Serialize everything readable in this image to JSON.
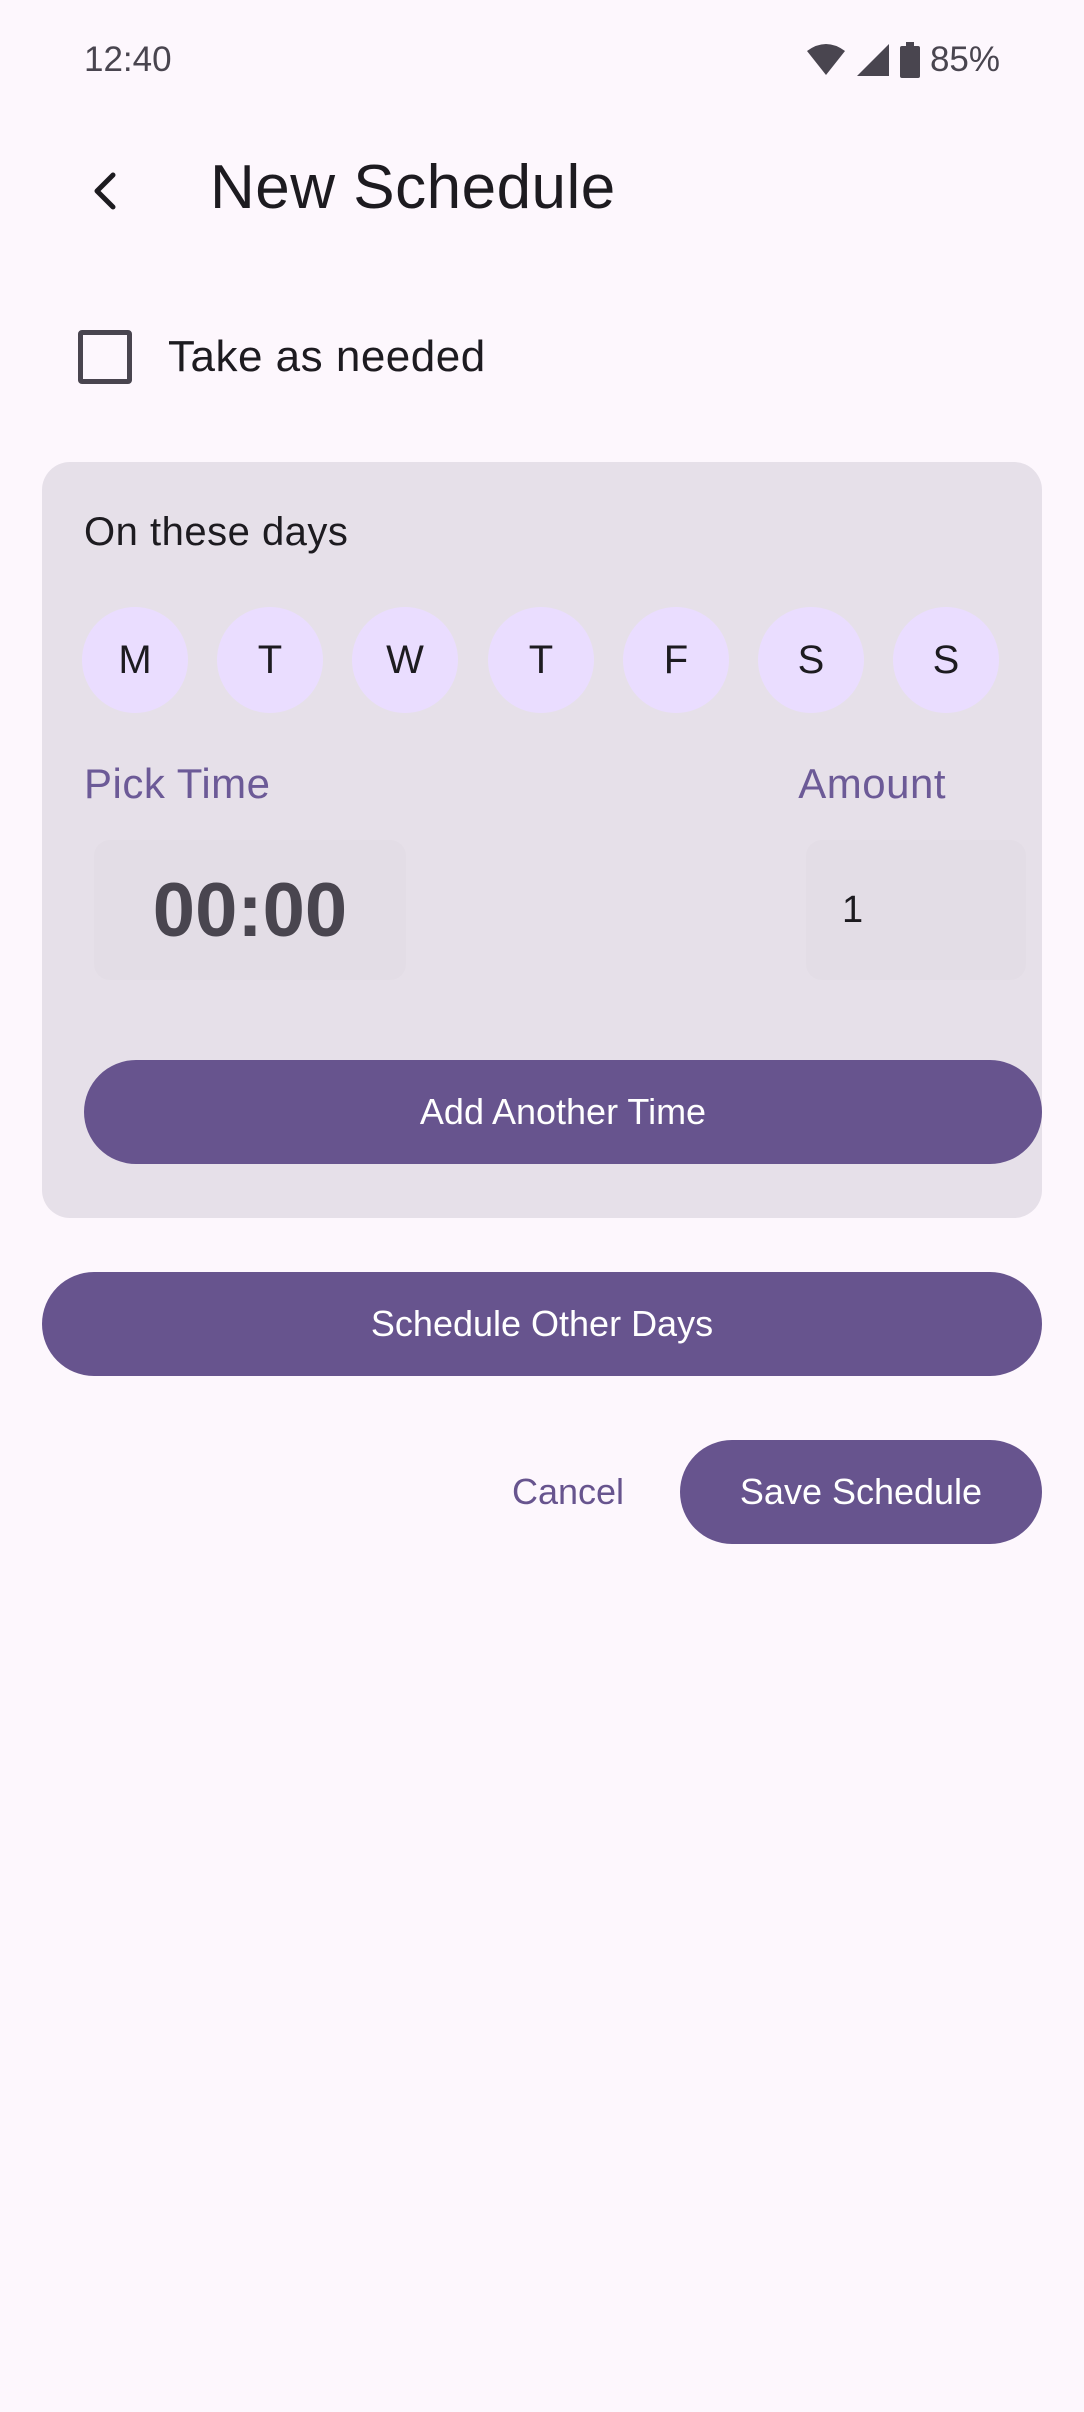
{
  "status_bar": {
    "time": "12:40",
    "battery": "85%",
    "icons": [
      "wifi-icon",
      "cell-signal-icon",
      "battery-icon"
    ]
  },
  "app_bar": {
    "back_icon": "chevron-left-icon",
    "title": "New Schedule"
  },
  "as_needed": {
    "label": "Take as needed",
    "checked": false
  },
  "days_card": {
    "heading": "On these days",
    "days": [
      "M",
      "T",
      "W",
      "T",
      "F",
      "S",
      "S"
    ],
    "pick_time_label": "Pick Time",
    "amount_label": "Amount",
    "time_value": "00:00",
    "amount_value": "1",
    "add_time_button": "Add Another Time"
  },
  "actions": {
    "schedule_other_days": "Schedule Other Days",
    "cancel": "Cancel",
    "save": "Save Schedule"
  },
  "colors": {
    "background": "#fdf7fd",
    "card": "#e6e0e9",
    "day_chip": "#eaddff",
    "primary": "#67548e",
    "label_accent": "#6c5a97"
  }
}
